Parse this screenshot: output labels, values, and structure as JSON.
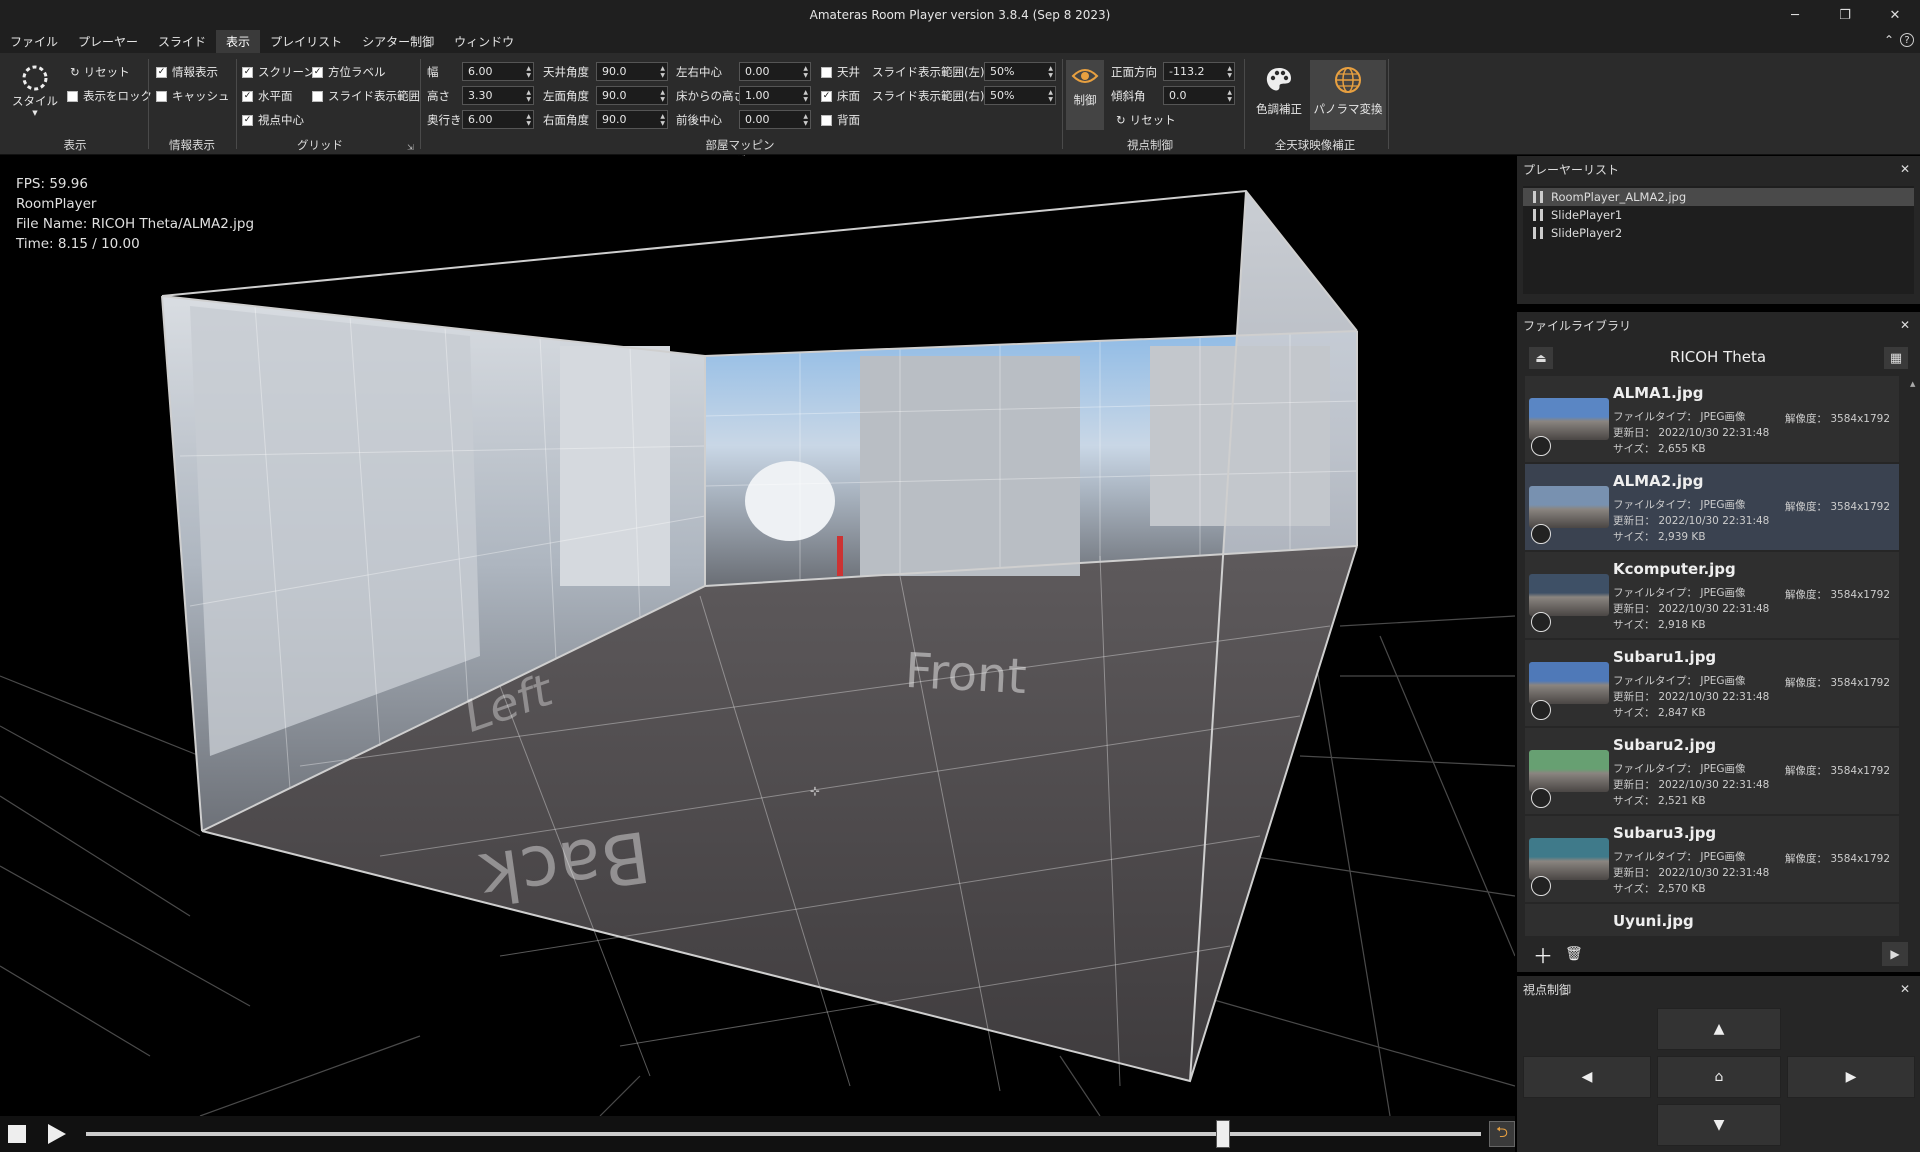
{
  "window": {
    "title": "Amateras Room Player version 3.8.4 (Sep  8 2023)",
    "minimize": "─",
    "maximize": "❐",
    "close": "✕"
  },
  "menu": {
    "items": [
      "ファイル",
      "プレーヤー",
      "スライド",
      "表示",
      "プレイリスト",
      "シアター制御",
      "ウィンドウ"
    ],
    "active_index": 3,
    "collapse": "⌃",
    "help": "?"
  },
  "ribbon": {
    "display": {
      "style_label": "スタイル",
      "reset": "リセット",
      "lock": "表示をロック",
      "group": "表示",
      "lock_checked": false
    },
    "info": {
      "show_info": "情報表示",
      "cache": "キャッシュ",
      "group": "情報表示",
      "show_info_checked": true,
      "cache_checked": false
    },
    "grid": {
      "screen": "スクリーン",
      "horizon": "水平面",
      "view_center": "視点中心",
      "orientation_label": "方位ラベル",
      "slide_range": "スライド表示範囲",
      "group": "グリッド",
      "screen_checked": true,
      "horizon_checked": true,
      "view_center_checked": true,
      "orientation_checked": true,
      "slide_range_checked": false
    },
    "mapping": {
      "group": "部屋マッピング",
      "width_label": "幅",
      "width": "6.00",
      "height_label": "高さ",
      "height": "3.30",
      "depth_label": "奥行き",
      "depth": "6.00",
      "ceiling_angle_label": "天井角度",
      "ceiling_angle": "90.0",
      "left_angle_label": "左面角度",
      "left_angle": "90.0",
      "right_angle_label": "右面角度",
      "right_angle": "90.0",
      "lr_center_label": "左右中心",
      "lr_center": "0.00",
      "floor_height_label": "床からの高さ",
      "floor_height": "1.00",
      "fb_center_label": "前後中心",
      "fb_center": "0.00",
      "ceiling": "天井",
      "floor": "床面",
      "back": "背面",
      "ceiling_checked": false,
      "floor_checked": true,
      "back_checked": false,
      "slide_left_label": "スライド表示範囲(左)",
      "slide_left": "50%",
      "slide_right_label": "スライド表示範囲(右)",
      "slide_right": "50%"
    },
    "view": {
      "group": "視点制御",
      "control": "制御",
      "direction_label": "正面方向",
      "direction": "-113.2",
      "tilt_label": "傾斜角",
      "tilt": "0.0",
      "reset": "リセット"
    },
    "omni": {
      "group": "全天球映像補正",
      "color": "色調補正",
      "panorama": "パノラマ変換"
    }
  },
  "viewport": {
    "fps": "FPS: 59.96",
    "player": "RoomPlayer",
    "file": "File Name: RICOH Theta/ALMA2.jpg",
    "time": "Time: 8.15 / 10.00",
    "labels": {
      "left": "Left",
      "front": "Front",
      "back": "Back"
    }
  },
  "transport": {
    "progress": 0.815
  },
  "player_list": {
    "title": "プレーヤーリスト",
    "items": [
      "RoomPlayer_ALMA2.jpg",
      "SlidePlayer1",
      "SlidePlayer2"
    ],
    "selected": 0
  },
  "library": {
    "title": "ファイルライブラリ",
    "folder": "RICOH Theta",
    "type_label": "ファイルタイプ：",
    "updated_label": "更新日：",
    "size_label": "サイズ：",
    "res_label": "解像度：",
    "items": [
      {
        "name": "ALMA1.jpg",
        "type": "JPEG画像",
        "updated": "2022/10/30 22:31:48",
        "size": "2,655 KB",
        "res": "3584x1792",
        "thumb": "#5a86c4"
      },
      {
        "name": "ALMA2.jpg",
        "type": "JPEG画像",
        "updated": "2022/10/30 22:31:48",
        "size": "2,939 KB",
        "res": "3584x1792",
        "thumb": "#7891b0"
      },
      {
        "name": "Kcomputer.jpg",
        "type": "JPEG画像",
        "updated": "2022/10/30 22:31:48",
        "size": "2,918 KB",
        "res": "3584x1792",
        "thumb": "#3e5066"
      },
      {
        "name": "Subaru1.jpg",
        "type": "JPEG画像",
        "updated": "2022/10/30 22:31:48",
        "size": "2,847 KB",
        "res": "3584x1792",
        "thumb": "#4f79b8"
      },
      {
        "name": "Subaru2.jpg",
        "type": "JPEG画像",
        "updated": "2022/10/30 22:31:48",
        "size": "2,521 KB",
        "res": "3584x1792",
        "thumb": "#67a072"
      },
      {
        "name": "Subaru3.jpg",
        "type": "JPEG画像",
        "updated": "2022/10/30 22:31:48",
        "size": "2,570 KB",
        "res": "3584x1792",
        "thumb": "#3f7a8a"
      },
      {
        "name": "Uyuni.jpg"
      }
    ],
    "selected": 1
  },
  "view_control": {
    "title": "視点制御",
    "up": "▲",
    "down": "▼",
    "left": "◀",
    "right": "▶",
    "home": "⌂"
  }
}
